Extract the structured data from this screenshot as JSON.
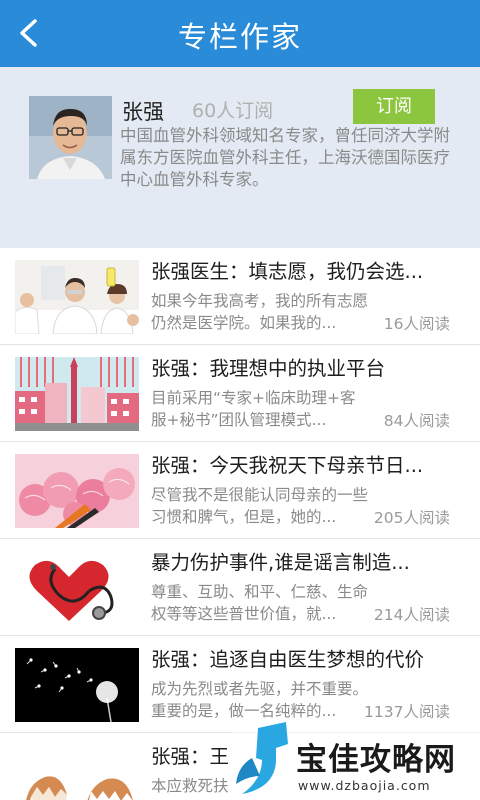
{
  "header": {
    "title": "专栏作家",
    "back_icon": "back-chevron-icon"
  },
  "author": {
    "name": "张强",
    "subscribers": "60人订阅",
    "subscribe_label": "订阅",
    "bio": "中国血管外科领域知名专家，曾任同济大学附属东方医院血管外科主任，上海沃德国际医疗中心血管外科专家。",
    "colors": {
      "subscribe_button": "#8cc63f",
      "header": "#2a8bd8",
      "profile_bg": "#e3eaf3"
    }
  },
  "articles": [
    {
      "title": "张强医生：填志愿，我仍会选...",
      "summary": "如果今年我高考，我的所有志愿仍然是医学院。如果我的...",
      "reads": "16人阅读",
      "thumb": "lab-scientists-image"
    },
    {
      "title": "张强：我理想中的执业平台",
      "summary": "目前采用“专家+临床助理+客服+秘书”团队管理模式...",
      "reads": "84人阅读",
      "thumb": "city-illustration-image"
    },
    {
      "title": "张强：今天我祝天下母亲节日...",
      "summary": "尽管我不是很能认同母亲的一些习惯和脾气，但是，她的...",
      "reads": "205人阅读",
      "thumb": "carnations-image"
    },
    {
      "title": "暴力伤护事件,谁是谣言制造...",
      "summary": "尊重、互助、和平、仁慈、生命权等等这些普世价值，就...",
      "reads": "214人阅读",
      "thumb": "heart-stethoscope-image"
    },
    {
      "title": "张强：追逐自由医生梦想的代价",
      "summary": "成为先烈或者先驱，并不重要。重要的是，做一名纯粹的...",
      "reads": "1137人阅读",
      "thumb": "dandelion-image"
    },
    {
      "title": "张强：王",
      "summary": "本应救死扶",
      "reads": "",
      "thumb": "eggshell-image"
    }
  ],
  "watermark": {
    "name": "宝佳攻略网",
    "url": "www.dzbaojia.com"
  }
}
